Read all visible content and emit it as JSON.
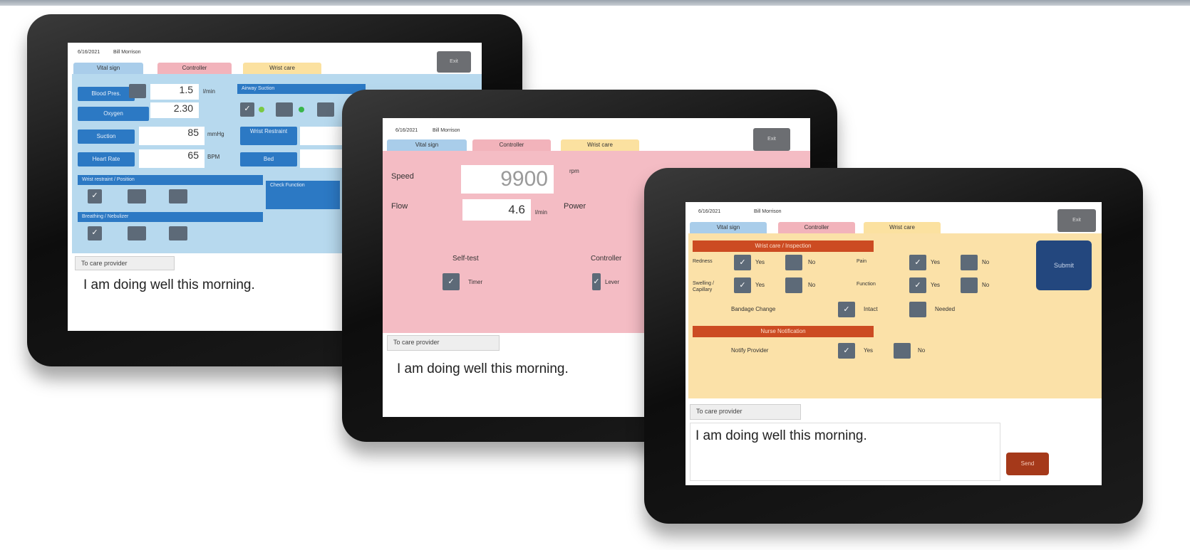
{
  "tablet1": {
    "header": {
      "date": "6/16/2021",
      "name": "Bill Morrison"
    },
    "tabs": [
      "Vital sign",
      "Controller",
      "Wrist care"
    ],
    "close_label": "Exit",
    "fields": [
      {
        "label": "Blood Pres.",
        "value": "1.5",
        "unit": "l/min"
      },
      {
        "label": "Oxygen",
        "value": "2.30",
        "unit": ""
      },
      {
        "label": "Suction",
        "value": "85",
        "unit": "mmHg"
      },
      {
        "label": "Heart Rate",
        "value": "65",
        "unit": "BPM"
      }
    ],
    "right_box_label": "Airway Suction",
    "right_labels": [
      "Wrist Restraint",
      "Bed"
    ],
    "bars": [
      "Wrist restraint / Position",
      "Breathing / Nebulizer",
      "Check Function"
    ],
    "checks": [
      "✓",
      "✓",
      "✓"
    ],
    "caption": "To care provider",
    "message": "I am doing well this morning."
  },
  "tablet2": {
    "header": {
      "date": "6/16/2021",
      "name": "Bill Morrison"
    },
    "tabs": [
      "Vital sign",
      "Controller",
      "Wrist care"
    ],
    "close_label": "Exit",
    "fields": [
      {
        "label": "Speed",
        "value": "9900",
        "unit": "rpm"
      },
      {
        "label": "Flow",
        "value": "4.6",
        "unit": "l/min"
      }
    ],
    "power_label": "Power",
    "options": [
      {
        "title": "Self-test",
        "sub": "Timer"
      },
      {
        "title": "Controller",
        "sub": "Lever"
      }
    ],
    "caption": "To care provider",
    "message": "I am doing well this morning."
  },
  "tablet3": {
    "header": {
      "date": "6/16/2021",
      "name": "Bill Morrison"
    },
    "tabs": [
      "Vital sign",
      "Controller",
      "Wrist care"
    ],
    "close_label": "Exit",
    "section1": "Wrist care / Inspection",
    "rows": [
      {
        "left": "Redness",
        "right": "Pain"
      },
      {
        "left": "Swelling / Capillary",
        "right": "Function"
      }
    ],
    "yes_label": "Yes",
    "no_label": "No",
    "bandage_label": "Bandage Change",
    "bandage_opts": [
      "Intact",
      "Needed"
    ],
    "section2": "Nurse Notification",
    "notify_label": "Notify Provider",
    "submit_label": "Submit",
    "send_label": "Send",
    "caption": "To care provider",
    "message": "I am doing well this morning."
  },
  "colors": {
    "blue_panel": "#b7d9ee",
    "pink_panel": "#f4bcc4",
    "yellow_panel": "#fbe1a8",
    "label_blue": "#2c79c4",
    "orange_bar": "#cc4b22"
  }
}
